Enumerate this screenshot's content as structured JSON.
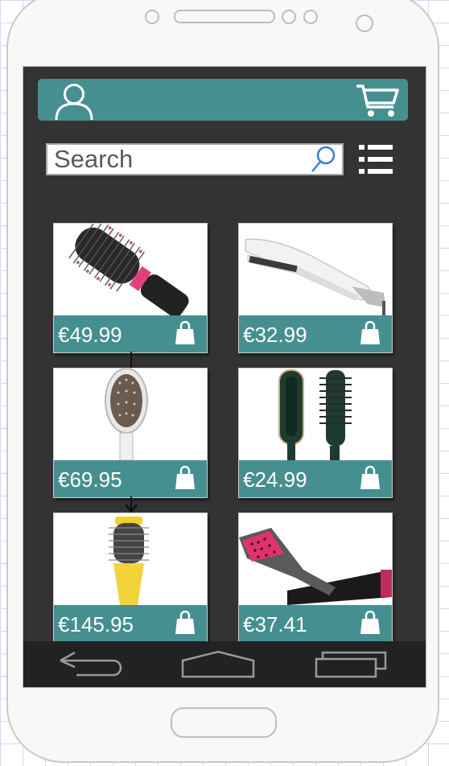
{
  "search": {
    "placeholder": "Search"
  },
  "products": [
    {
      "price": "€49.99",
      "item": "round-brush-dryer"
    },
    {
      "price": "€32.99",
      "item": "flat-iron"
    },
    {
      "price": "€69.95",
      "item": "straightening-brush"
    },
    {
      "price": "€24.99",
      "item": "straightening-combs"
    },
    {
      "price": "€145.95",
      "item": "volumizer-brush"
    },
    {
      "price": "€37.41",
      "item": "pink-straightening-brush"
    }
  ],
  "icons": {
    "user": "user-icon",
    "cart": "cart-icon",
    "search": "search-icon",
    "menu": "menu-icon",
    "bag": "shopping-bag-icon",
    "back": "back-icon",
    "home": "home-icon",
    "recents": "recents-icon"
  },
  "colors": {
    "accent": "#468f91",
    "screen": "#333333",
    "navbar": "#222222"
  }
}
